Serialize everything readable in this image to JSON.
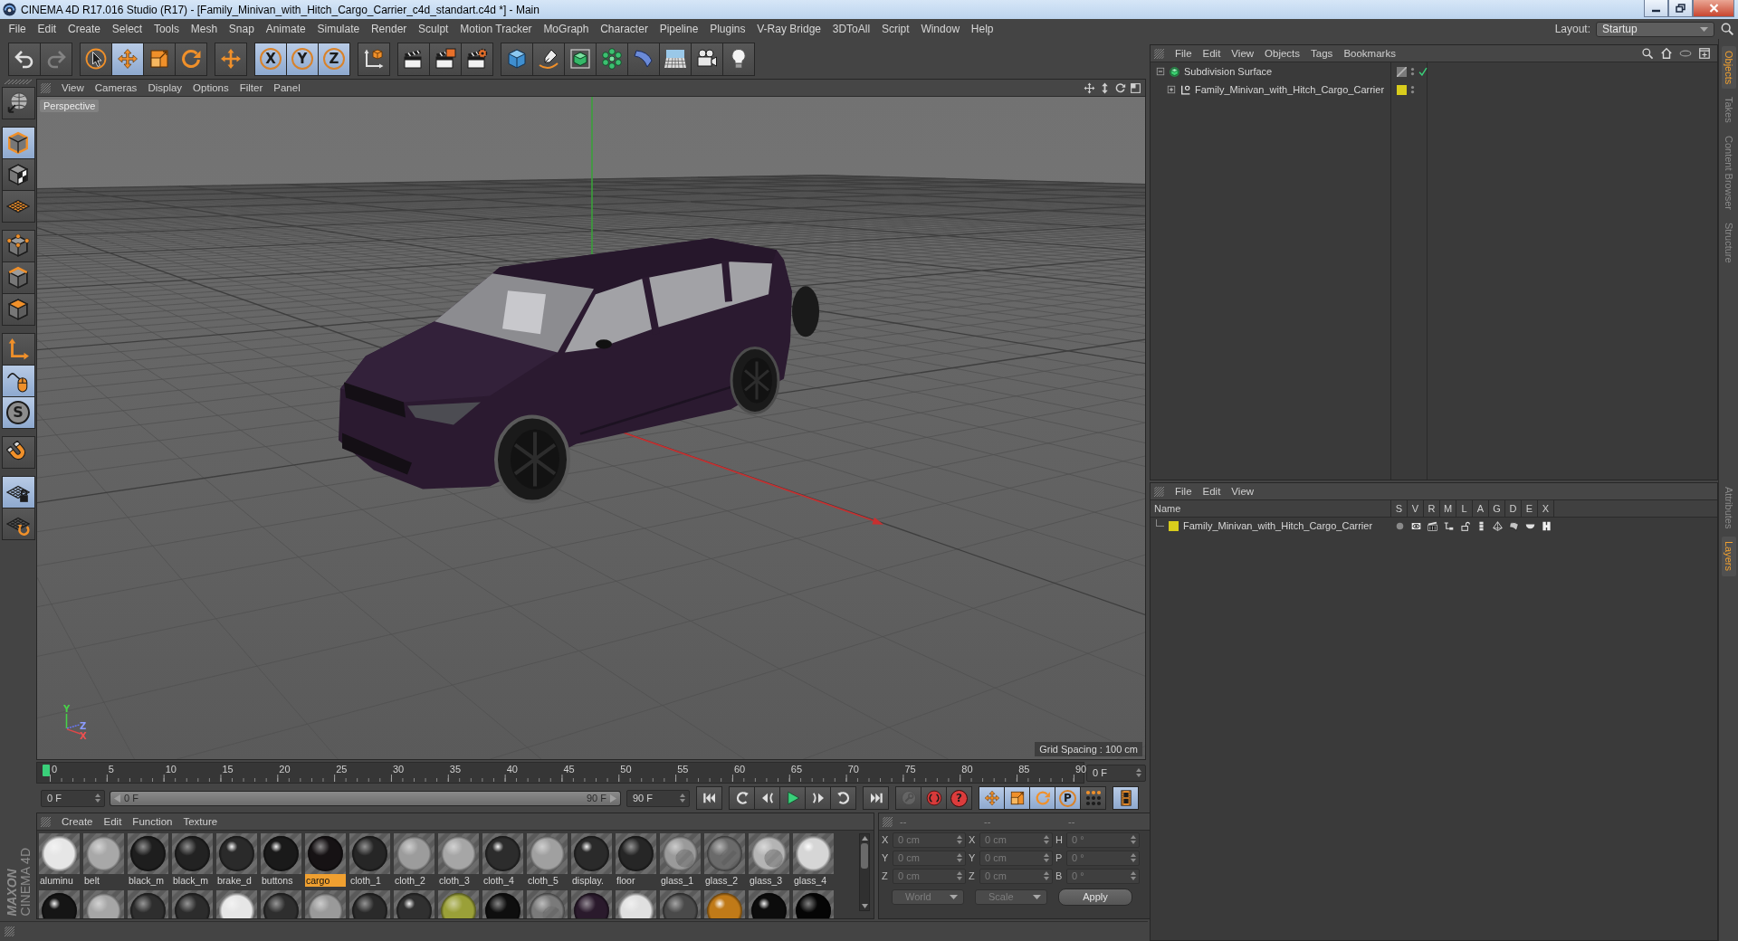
{
  "window": {
    "title": "CINEMA 4D R17.016 Studio (R17) - [Family_Minivan_with_Hitch_Cargo_Carrier_c4d_standart.c4d *] - Main"
  },
  "menu": [
    "File",
    "Edit",
    "Create",
    "Select",
    "Tools",
    "Mesh",
    "Snap",
    "Animate",
    "Simulate",
    "Render",
    "Sculpt",
    "Motion Tracker",
    "MoGraph",
    "Character",
    "Pipeline",
    "Plugins",
    "V-Ray Bridge",
    "3DToAll",
    "Script",
    "Window",
    "Help"
  ],
  "layout": {
    "label": "Layout:",
    "value": "Startup"
  },
  "toolbar": {
    "groups": [
      {
        "items": [
          {
            "kind": "undo",
            "on": false,
            "disabled": false
          },
          {
            "kind": "redo",
            "on": false,
            "disabled": true
          }
        ]
      },
      {
        "items": [
          {
            "kind": "select",
            "on": false,
            "disabled": false
          },
          {
            "kind": "move",
            "on": true,
            "disabled": false
          },
          {
            "kind": "scale",
            "on": false,
            "disabled": false
          },
          {
            "kind": "rotate",
            "on": false,
            "disabled": false
          }
        ]
      },
      {
        "items": [
          {
            "kind": "transform",
            "on": false,
            "disabled": false
          }
        ]
      },
      {
        "items": [
          {
            "kind": "x-lock",
            "glyph": "X",
            "on": true,
            "disabled": false
          },
          {
            "kind": "y-lock",
            "glyph": "Y",
            "on": true,
            "disabled": false
          },
          {
            "kind": "z-lock",
            "glyph": "Z",
            "on": true,
            "disabled": false
          }
        ]
      },
      {
        "items": [
          {
            "kind": "coords",
            "on": false,
            "disabled": false
          }
        ]
      },
      {
        "items": [
          {
            "kind": "render-view",
            "on": false,
            "disabled": false
          },
          {
            "kind": "render-picture",
            "on": false,
            "disabled": false
          },
          {
            "kind": "render-settings",
            "on": false,
            "disabled": false
          }
        ]
      },
      {
        "items": [
          {
            "kind": "cube",
            "on": false,
            "disabled": false
          },
          {
            "kind": "pen",
            "on": false,
            "disabled": false
          },
          {
            "kind": "subdivision",
            "on": false,
            "disabled": false
          },
          {
            "kind": "cloner",
            "on": false,
            "disabled": false
          },
          {
            "kind": "deformer",
            "on": false,
            "disabled": false
          },
          {
            "kind": "floor",
            "on": false,
            "disabled": false
          },
          {
            "kind": "camera",
            "on": false,
            "disabled": false
          },
          {
            "kind": "light",
            "on": false,
            "disabled": false
          }
        ]
      }
    ]
  },
  "mode_tools": {
    "groups": [
      {
        "items": [
          {
            "kind": "make-editable",
            "on": false
          }
        ]
      },
      {
        "items": [
          {
            "kind": "model",
            "on": true
          },
          {
            "kind": "texture",
            "on": false
          },
          {
            "kind": "workplane",
            "on": false
          }
        ]
      },
      {
        "items": [
          {
            "kind": "points",
            "on": false
          },
          {
            "kind": "edges",
            "on": false
          },
          {
            "kind": "polygons",
            "on": false
          }
        ]
      },
      {
        "items": [
          {
            "kind": "axis",
            "on": false
          },
          {
            "kind": "tweak",
            "on": true
          },
          {
            "kind": "solo",
            "glyph": "S",
            "on": true
          }
        ]
      },
      {
        "items": [
          {
            "kind": "snap",
            "on": false
          }
        ]
      },
      {
        "items": [
          {
            "kind": "lock-workplane",
            "on": true
          },
          {
            "kind": "planar-workplane",
            "on": false
          }
        ]
      }
    ]
  },
  "viewport": {
    "menu": [
      "View",
      "Cameras",
      "Display",
      "Options",
      "Filter",
      "Panel"
    ],
    "camera": "Perspective",
    "grid_spacing": "Grid Spacing : 100 cm",
    "gizmo_labels": [
      "Y",
      "Z",
      "X"
    ]
  },
  "timeline": {
    "ticks": [
      "0",
      "5",
      "10",
      "15",
      "20",
      "25",
      "30",
      "35",
      "40",
      "45",
      "50",
      "55",
      "60",
      "65",
      "70",
      "75",
      "80",
      "85",
      "90"
    ],
    "level": 0,
    "current_frame": "0 F"
  },
  "playback": {
    "start": "0 F",
    "range": {
      "start": "0 F",
      "end": "90 F",
      "level": 1
    },
    "end": "90 F",
    "groups": [
      {
        "items": [
          {
            "kind": "go-start",
            "on": false,
            "disabled": false
          }
        ]
      },
      {
        "items": [
          {
            "kind": "prev-key",
            "on": false,
            "disabled": false
          },
          {
            "kind": "prev-frame",
            "on": false,
            "disabled": false
          },
          {
            "kind": "play",
            "on": false,
            "disabled": false
          },
          {
            "kind": "next-frame",
            "on": false,
            "disabled": false
          },
          {
            "kind": "next-key",
            "on": false,
            "disabled": false
          }
        ]
      },
      {
        "items": [
          {
            "kind": "go-end",
            "on": false,
            "disabled": false
          }
        ]
      },
      {
        "items": [
          {
            "kind": "record-key",
            "on": false,
            "disabled": true
          },
          {
            "kind": "auto-key",
            "on": false,
            "disabled": false
          },
          {
            "kind": "key-selection",
            "glyph": "?",
            "on": false,
            "disabled": false
          }
        ]
      },
      {
        "items": [
          {
            "kind": "key-position",
            "on": true,
            "disabled": false
          },
          {
            "kind": "key-scale",
            "on": true,
            "disabled": false
          },
          {
            "kind": "key-rotation",
            "on": true,
            "disabled": false
          },
          {
            "kind": "key-param",
            "glyph": "P",
            "on": true,
            "disabled": false
          },
          {
            "kind": "key-pla",
            "on": false,
            "disabled": false
          }
        ]
      },
      {
        "items": [
          {
            "kind": "timeline",
            "on": true,
            "disabled": false
          }
        ]
      }
    ]
  },
  "material_manager": {
    "menu": [
      "Create",
      "Edit",
      "Function",
      "Texture"
    ],
    "materials": [
      {
        "name": "aluminu",
        "color": "#e6e6e6",
        "kind": "matte",
        "selected": false
      },
      {
        "name": "belt",
        "color": "#a8a8a8",
        "kind": "matte",
        "selected": false
      },
      {
        "name": "black_m",
        "color": "#1e1e1e",
        "kind": "matte",
        "selected": false
      },
      {
        "name": "black_m",
        "color": "#222222",
        "kind": "matte",
        "selected": false
      },
      {
        "name": "brake_d",
        "color": "#2a2a2a",
        "kind": "glossy",
        "selected": false
      },
      {
        "name": "buttons",
        "color": "#1a1a1a",
        "kind": "glossy",
        "selected": false
      },
      {
        "name": "cargo",
        "color": "#161214",
        "kind": "matte",
        "selected": true
      },
      {
        "name": "cloth_1",
        "color": "#262626",
        "kind": "matte",
        "selected": false
      },
      {
        "name": "cloth_2",
        "color": "#9c9c9c",
        "kind": "matte",
        "selected": false
      },
      {
        "name": "cloth_3",
        "color": "#a6a6a6",
        "kind": "matte",
        "selected": false
      },
      {
        "name": "cloth_4",
        "color": "#2c2c2c",
        "kind": "glossy",
        "selected": false
      },
      {
        "name": "cloth_5",
        "color": "#a0a0a0",
        "kind": "matte",
        "selected": false
      },
      {
        "name": "display.",
        "color": "#2a2a2a",
        "kind": "glossy",
        "selected": false
      },
      {
        "name": "floor",
        "color": "#262626",
        "kind": "matte",
        "selected": false
      },
      {
        "name": "glass_1",
        "color": "#9a9a9a",
        "kind": "glass",
        "selected": false
      },
      {
        "name": "glass_2",
        "color": "#6a6a6a",
        "kind": "glass",
        "selected": false
      },
      {
        "name": "glass_3",
        "color": "#b4b4b4",
        "kind": "glass",
        "selected": false
      },
      {
        "name": "glass_4",
        "color": "#d6d6d6",
        "kind": "glossy",
        "selected": false
      },
      {
        "color": "#151515",
        "kind": "glossy",
        "selected": false
      },
      {
        "color": "#a6a6a6",
        "kind": "matte",
        "selected": false
      },
      {
        "color": "#2e2e2e",
        "kind": "matte",
        "selected": false
      },
      {
        "color": "#2c2c2c",
        "kind": "matte",
        "selected": false
      },
      {
        "color": "#e6e6e6",
        "kind": "matte",
        "selected": false
      },
      {
        "color": "#2e2e2e",
        "kind": "matte",
        "selected": false
      },
      {
        "color": "#9a9a9a",
        "kind": "matte",
        "selected": false
      },
      {
        "color": "#2a2a2a",
        "kind": "matte",
        "selected": false
      },
      {
        "color": "#303030",
        "kind": "glossy",
        "selected": false
      },
      {
        "color": "#9aa038",
        "kind": "matte",
        "selected": false
      },
      {
        "color": "#0e0e0e",
        "kind": "matte",
        "selected": false
      },
      {
        "color": "#7a7a7a",
        "kind": "glass",
        "selected": false
      },
      {
        "color": "#2a1a2c",
        "kind": "matte",
        "selected": false
      },
      {
        "color": "#e0e0e0",
        "kind": "matte",
        "selected": false
      },
      {
        "color": "#4a4a4a",
        "kind": "matte",
        "selected": false
      },
      {
        "color": "#c07a18",
        "kind": "glossy",
        "selected": false
      },
      {
        "color": "#0c0c0c",
        "kind": "glossy",
        "selected": false
      },
      {
        "color": "#050505",
        "kind": "matte",
        "selected": false
      }
    ]
  },
  "coordinates": {
    "headers": [
      "--",
      "--",
      "--"
    ],
    "rows": [
      [
        {
          "label": "X",
          "value": "0 cm"
        },
        {
          "label": "X",
          "value": "0 cm"
        },
        {
          "label": "H",
          "value": "0 °"
        }
      ],
      [
        {
          "label": "Y",
          "value": "0 cm"
        },
        {
          "label": "Y",
          "value": "0 cm"
        },
        {
          "label": "P",
          "value": "0 °"
        }
      ],
      [
        {
          "label": "Z",
          "value": "0 cm"
        },
        {
          "label": "Z",
          "value": "0 cm"
        },
        {
          "label": "B",
          "value": "0 °"
        }
      ]
    ],
    "dropdowns": [
      "World",
      "Scale"
    ],
    "apply": "Apply",
    "disabled": true
  },
  "logo": {
    "brand": "MAXON",
    "product": "CINEMA 4D"
  },
  "object_manager": {
    "menu": [
      "File",
      "Edit",
      "View",
      "Objects",
      "Tags",
      "Bookmarks"
    ],
    "objects": [
      {
        "name": "Subdivision Surface",
        "kind": "subdivision",
        "expanded": true,
        "enabled": true,
        "children": [
          {
            "name": "Family_Minivan_with_Hitch_Cargo_Carrier",
            "kind": "null",
            "expanded": false,
            "color": "#d8cc1c"
          }
        ]
      }
    ]
  },
  "layer_manager": {
    "menu": [
      "File",
      "Edit",
      "View"
    ],
    "columns": [
      "Name",
      "S",
      "V",
      "R",
      "M",
      "L",
      "A",
      "G",
      "D",
      "E",
      "X"
    ],
    "layers": [
      {
        "name": "Family_Minivan_with_Hitch_Cargo_Carrier",
        "color": "#d8cc1c"
      }
    ]
  },
  "side_tabs_top": [
    {
      "label": "Objects",
      "selected": true
    },
    {
      "label": "Takes",
      "selected": false
    },
    {
      "label": "Content Browser",
      "selected": false
    },
    {
      "label": "Structure",
      "selected": false
    }
  ],
  "side_tabs_bottom": [
    {
      "label": "Attributes",
      "selected": false
    },
    {
      "label": "Layers",
      "selected": true
    }
  ]
}
